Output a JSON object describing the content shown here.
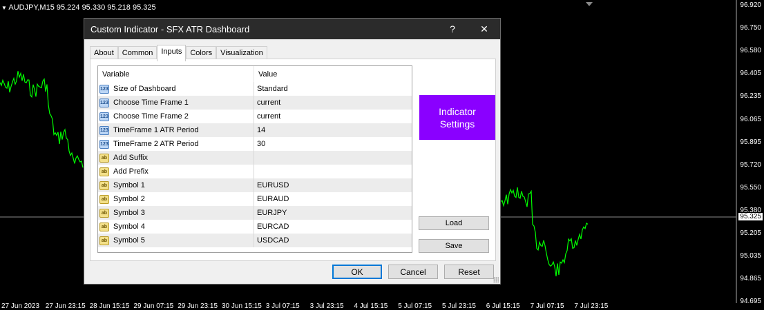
{
  "chart": {
    "symbol_label": "AUDJPY,M15  95.224 95.330 95.218 95.325",
    "price_levels": [
      "96.920",
      "96.750",
      "96.580",
      "96.405",
      "96.235",
      "96.065",
      "95.895",
      "95.720",
      "95.550",
      "95.380",
      "95.205",
      "95.035",
      "94.865",
      "94.695"
    ],
    "current_price": "95.325",
    "time_labels": [
      "27 Jun 2023",
      "27 Jun 23:15",
      "28 Jun 15:15",
      "29 Jun 07:15",
      "29 Jun 23:15",
      "30 Jun 15:15",
      "3 Jul 07:15",
      "3 Jul 23:15",
      "4 Jul 15:15",
      "5 Jul 07:15",
      "5 Jul 23:15",
      "6 Jul 15:15",
      "7 Jul 07:15",
      "7 Jul 23:15"
    ],
    "line_color": "#00ff00"
  },
  "dialog": {
    "title": "Custom Indicator - SFX ATR Dashboard",
    "help_label": "?",
    "close_label": "✕",
    "tabs": [
      {
        "label": "About"
      },
      {
        "label": "Common"
      },
      {
        "label": "Inputs"
      },
      {
        "label": "Colors"
      },
      {
        "label": "Visualization"
      }
    ],
    "active_tab": "Inputs",
    "grid": {
      "col_variable": "Variable",
      "col_value": "Value",
      "rows": [
        {
          "icon": "123",
          "variable": "Size of Dashboard",
          "value": "Standard"
        },
        {
          "icon": "123",
          "variable": "Choose Time Frame 1",
          "value": "current"
        },
        {
          "icon": "123",
          "variable": "Choose Time Frame 2",
          "value": "current"
        },
        {
          "icon": "123",
          "variable": "TimeFrame 1 ATR Period",
          "value": "14"
        },
        {
          "icon": "123",
          "variable": "TimeFrame 2 ATR Period",
          "value": "30"
        },
        {
          "icon": "ab",
          "variable": "Add Suffix",
          "value": ""
        },
        {
          "icon": "ab",
          "variable": "Add Prefix",
          "value": ""
        },
        {
          "icon": "ab",
          "variable": "Symbol 1",
          "value": "EURUSD"
        },
        {
          "icon": "ab",
          "variable": "Symbol 2",
          "value": "EURAUD"
        },
        {
          "icon": "ab",
          "variable": "Symbol 3",
          "value": "EURJPY"
        },
        {
          "icon": "ab",
          "variable": "Symbol 4",
          "value": "EURCAD"
        },
        {
          "icon": "ab",
          "variable": "Symbol 5",
          "value": "USDCAD"
        }
      ]
    },
    "indicator_box": {
      "line1": "Indicator",
      "line2": "Settings",
      "color": "#8a00ff"
    },
    "load_label": "Load",
    "save_label": "Save",
    "ok_label": "OK",
    "cancel_label": "Cancel",
    "reset_label": "Reset"
  }
}
